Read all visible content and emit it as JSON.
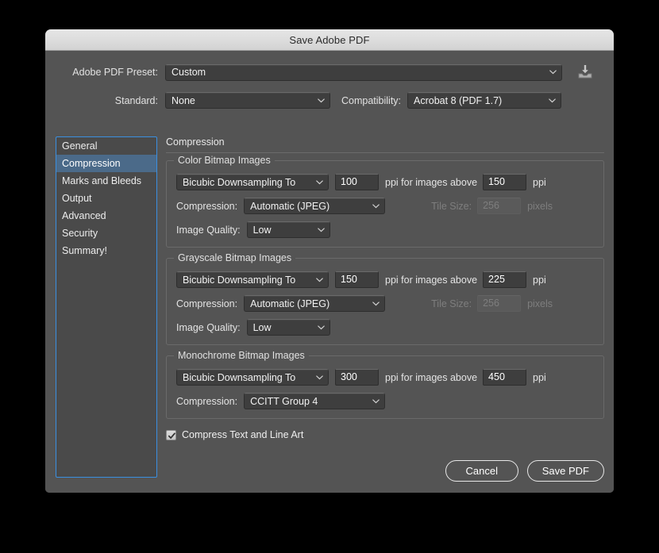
{
  "window": {
    "title": "Save Adobe PDF"
  },
  "top": {
    "preset_label": "Adobe PDF Preset:",
    "preset_value": "Custom",
    "standard_label": "Standard:",
    "standard_value": "None",
    "compatibility_label": "Compatibility:",
    "compatibility_value": "Acrobat 8 (PDF 1.7)",
    "export_icon": "save-download-icon"
  },
  "sidebar": {
    "items": [
      {
        "label": "General",
        "selected": false
      },
      {
        "label": "Compression",
        "selected": true
      },
      {
        "label": "Marks and Bleeds",
        "selected": false
      },
      {
        "label": "Output",
        "selected": false
      },
      {
        "label": "Advanced",
        "selected": false
      },
      {
        "label": "Security",
        "selected": false
      },
      {
        "label": "Summary!",
        "selected": false
      }
    ]
  },
  "pane": {
    "title": "Compression",
    "color_group": {
      "title": "Color Bitmap Images",
      "downsample_value": "Bicubic Downsampling To",
      "ppi_value": "100",
      "mid_text": "ppi for images above",
      "threshold_value": "150",
      "ppi_suffix": "ppi",
      "compression_label": "Compression:",
      "compression_value": "Automatic (JPEG)",
      "tile_size_label": "Tile Size:",
      "tile_size_value": "256",
      "tile_size_suffix": "pixels",
      "quality_label": "Image Quality:",
      "quality_value": "Low"
    },
    "grayscale_group": {
      "title": "Grayscale Bitmap Images",
      "downsample_value": "Bicubic Downsampling To",
      "ppi_value": "150",
      "mid_text": "ppi for images above",
      "threshold_value": "225",
      "ppi_suffix": "ppi",
      "compression_label": "Compression:",
      "compression_value": "Automatic (JPEG)",
      "tile_size_label": "Tile Size:",
      "tile_size_value": "256",
      "tile_size_suffix": "pixels",
      "quality_label": "Image Quality:",
      "quality_value": "Low"
    },
    "monochrome_group": {
      "title": "Monochrome Bitmap Images",
      "downsample_value": "Bicubic Downsampling To",
      "ppi_value": "300",
      "mid_text": "ppi for images above",
      "threshold_value": "450",
      "ppi_suffix": "ppi",
      "compression_label": "Compression:",
      "compression_value": "CCITT Group 4"
    },
    "compress_text_checkbox": {
      "label": "Compress Text and Line Art",
      "checked": true
    }
  },
  "footer": {
    "cancel_label": "Cancel",
    "save_label": "Save PDF"
  },
  "colors": {
    "dialog_bg": "#545454",
    "titlebar": "#dcdcdc",
    "selection_blue": "#4b6a89",
    "focus_ring_blue": "#3a8fe0",
    "field_bg": "#3e3e3e"
  }
}
